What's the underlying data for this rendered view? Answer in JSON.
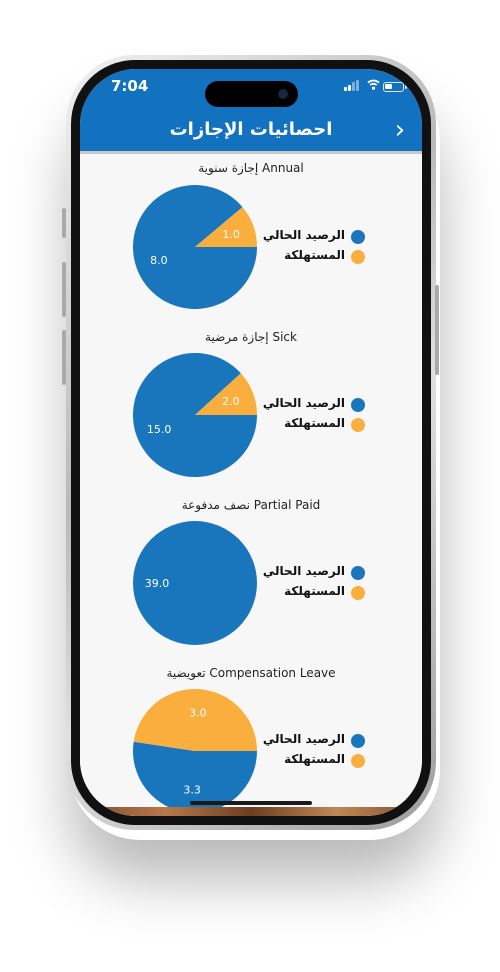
{
  "status_bar": {
    "time": "7:04"
  },
  "header": {
    "title": "احصائيات الإجازات",
    "back_icon": "chevron-right-icon"
  },
  "colors": {
    "primary": "#1272bf",
    "current_balance": "#1976bd",
    "consumed": "#f9ae3e"
  },
  "legend": {
    "current_balance": "الرصيد الحالي",
    "consumed": "المستهلكة"
  },
  "chart_data": [
    {
      "type": "pie",
      "title": "إجازة سنوية Annual",
      "labels": [
        "الرصيد الحالي",
        "المستهلكة"
      ],
      "values": [
        8.0,
        1.0
      ],
      "value_labels": [
        "8.0",
        "1.0"
      ]
    },
    {
      "type": "pie",
      "title": "إجازة مرضية Sick",
      "labels": [
        "الرصيد الحالي",
        "المستهلكة"
      ],
      "values": [
        15.0,
        2.0
      ],
      "value_labels": [
        "15.0",
        "2.0"
      ]
    },
    {
      "type": "pie",
      "title": "نصف مدفوعة Partial Paid",
      "labels": [
        "الرصيد الحالي",
        "المستهلكة"
      ],
      "values": [
        39.0,
        0
      ],
      "value_labels": [
        "39.0",
        ""
      ]
    },
    {
      "type": "pie",
      "title": "تعويضية Compensation Leave",
      "labels": [
        "الرصيد الحالي",
        "المستهلكة"
      ],
      "values": [
        3.3,
        3.0
      ],
      "value_labels": [
        "3.3",
        "3.0"
      ]
    }
  ]
}
